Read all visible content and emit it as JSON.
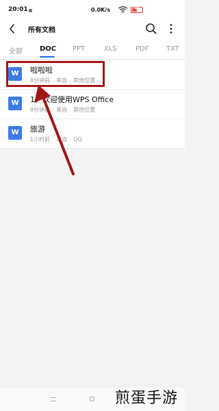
{
  "status_bar": {
    "time": "20:01",
    "net_speed": "0.0K/s",
    "battery_label": "47",
    "battery_level_percent": 47,
    "icons": [
      "notification-dot-icon",
      "wifi-icon",
      "battery-icon"
    ]
  },
  "header": {
    "title": "所有文档",
    "icons": [
      "back-arrow-icon",
      "search-icon",
      "more-vertical-icon"
    ]
  },
  "tabs": [
    {
      "label": "全部"
    },
    {
      "label": "DOC",
      "selected": true
    },
    {
      "label": "PPT"
    },
    {
      "label": "XLS"
    },
    {
      "label": "PDF"
    },
    {
      "label": "TXT"
    }
  ],
  "files": [
    {
      "name": "啦啦啦",
      "time": "8分钟前",
      "source_prefix": "来自",
      "source": "其他位置",
      "icon": "word-doc-icon",
      "icon_letter": "W"
    },
    {
      "name": "1、欢迎使用WPS Office",
      "time": "9分钟前",
      "source_prefix": "来自",
      "source": "其他位置",
      "icon": "word-doc-icon",
      "icon_letter": "W"
    },
    {
      "name": "旅游",
      "time": "1小时前",
      "source_prefix": "来自",
      "source": "QQ",
      "icon": "word-doc-icon",
      "icon_letter": "W"
    }
  ],
  "annotation": {
    "highlight_color": "#a51616",
    "arrow_color": "#a51616"
  },
  "watermark": {
    "text": "煎蛋手游"
  },
  "colors": {
    "accent": "#1f6bf0",
    "doc_icon": "#3d7be7",
    "background": "#f3f3f3"
  }
}
